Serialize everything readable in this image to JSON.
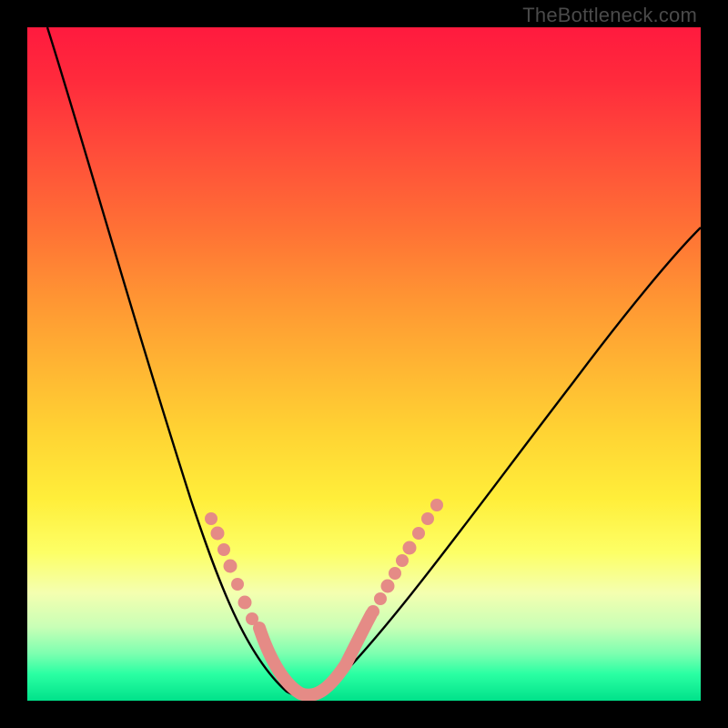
{
  "watermark": "TheBottleneck.com",
  "chart_data": {
    "type": "line",
    "title": "",
    "xlabel": "",
    "ylabel": "",
    "xlim": [
      0,
      100
    ],
    "ylim": [
      0,
      100
    ],
    "background_gradient": {
      "stops": [
        {
          "pos": 0,
          "color": "#ff1a3e"
        },
        {
          "pos": 50,
          "color": "#ffd333"
        },
        {
          "pos": 78,
          "color": "#fdff66"
        },
        {
          "pos": 100,
          "color": "#00e28a"
        }
      ]
    },
    "series": [
      {
        "name": "bottleneck-curve",
        "stroke": "#000000",
        "x": [
          3,
          6,
          9,
          12,
          15,
          18,
          21,
          24,
          27,
          30,
          32,
          34,
          36,
          38,
          40,
          44,
          48,
          52,
          56,
          60,
          66,
          72,
          78,
          84,
          90,
          96,
          100
        ],
        "y": [
          100,
          93,
          85,
          77,
          69,
          61,
          53,
          45,
          37,
          29,
          23,
          17,
          11,
          6,
          2,
          2,
          6,
          11,
          16,
          22,
          30,
          38,
          45,
          52,
          58,
          64,
          68
        ]
      },
      {
        "name": "highlight-dots-left",
        "type": "scatter",
        "color": "#e58b86",
        "x": [
          27.5,
          28.5,
          29.5,
          30.5,
          31.5,
          32.5,
          33.5,
          34.5
        ],
        "y": [
          27,
          25,
          23,
          21,
          18,
          16,
          13,
          10
        ]
      },
      {
        "name": "highlight-dots-right",
        "type": "scatter",
        "color": "#e58b86",
        "x": [
          42,
          43,
          44,
          45,
          46,
          47,
          48.5,
          50,
          51.5,
          53
        ],
        "y": [
          4,
          6,
          8,
          10,
          12,
          14,
          17,
          20,
          23,
          26
        ]
      },
      {
        "name": "valley-band",
        "type": "line",
        "color": "#e58b86",
        "x": [
          34.5,
          36,
          37.5,
          39,
          40.5,
          42
        ],
        "y": [
          10,
          6,
          3,
          2,
          3,
          4
        ]
      }
    ]
  }
}
